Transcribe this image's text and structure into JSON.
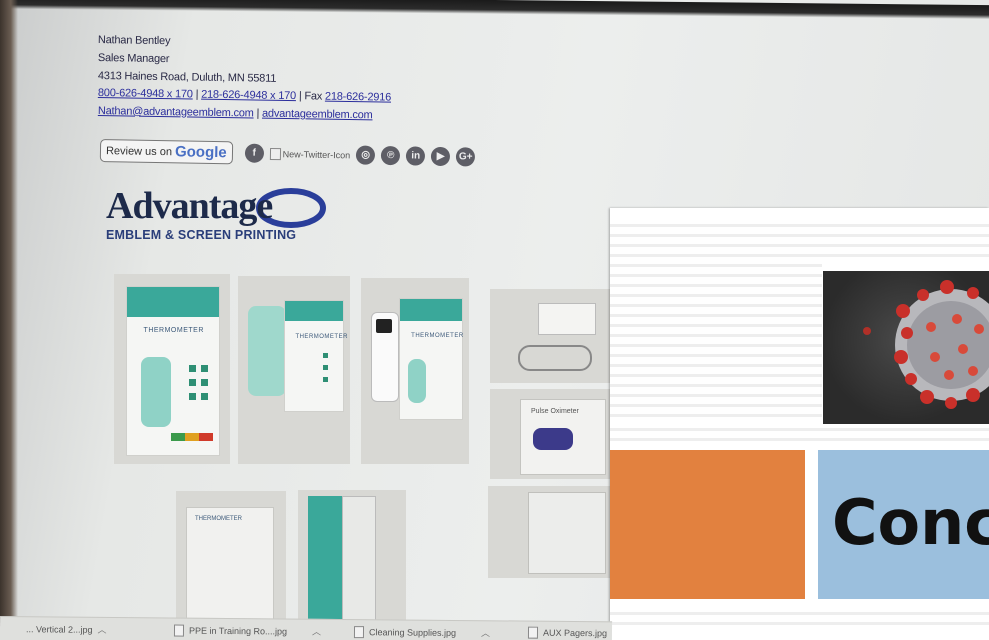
{
  "signature": {
    "name": "Nathan Bentley",
    "title": "Sales Manager",
    "address": "4313 Haines Road, Duluth, MN 55811",
    "phone1": "800-626-4948 x 170",
    "sep1": " | ",
    "phone2": "218-626-4948 x 170",
    "fax_label": " | Fax ",
    "fax": "218-626-2916",
    "email": "Nathan@advantageemblem.com",
    "sep2": " | ",
    "website": "advantageemblem.com"
  },
  "social": {
    "review_prefix": "Review us on",
    "review_brand": "Google",
    "broken_image_alt": "New-Twitter-Icon",
    "icons": [
      {
        "name": "facebook-icon",
        "glyph": "f"
      },
      {
        "name": "instagram-icon",
        "glyph": "◎"
      },
      {
        "name": "pinterest-icon",
        "glyph": "℗"
      },
      {
        "name": "linkedin-icon",
        "glyph": "in"
      },
      {
        "name": "youtube-icon",
        "glyph": "▶"
      },
      {
        "name": "google-plus-icon",
        "glyph": "G+"
      }
    ]
  },
  "logo": {
    "word": "Advantage",
    "sub": "EMBLEM & SCREEN PRINTING",
    "brand_color": "#1d2a4a",
    "accent_color": "#2a3e7a"
  },
  "photos": {
    "thermometer_label": "THERMOMETER",
    "oximeter_label": "Pulse Oximeter"
  },
  "overlay": {
    "concept_text": "Conc",
    "orange": "#e2813f",
    "blue": "#9bbfdd"
  },
  "taskbar": {
    "items": [
      {
        "label": "... Vertical 2...jpg"
      },
      {
        "label": "PPE in Training Ro....jpg"
      },
      {
        "label": "Cleaning Supplies.jpg"
      },
      {
        "label": "AUX Pagers.jpg"
      }
    ]
  }
}
